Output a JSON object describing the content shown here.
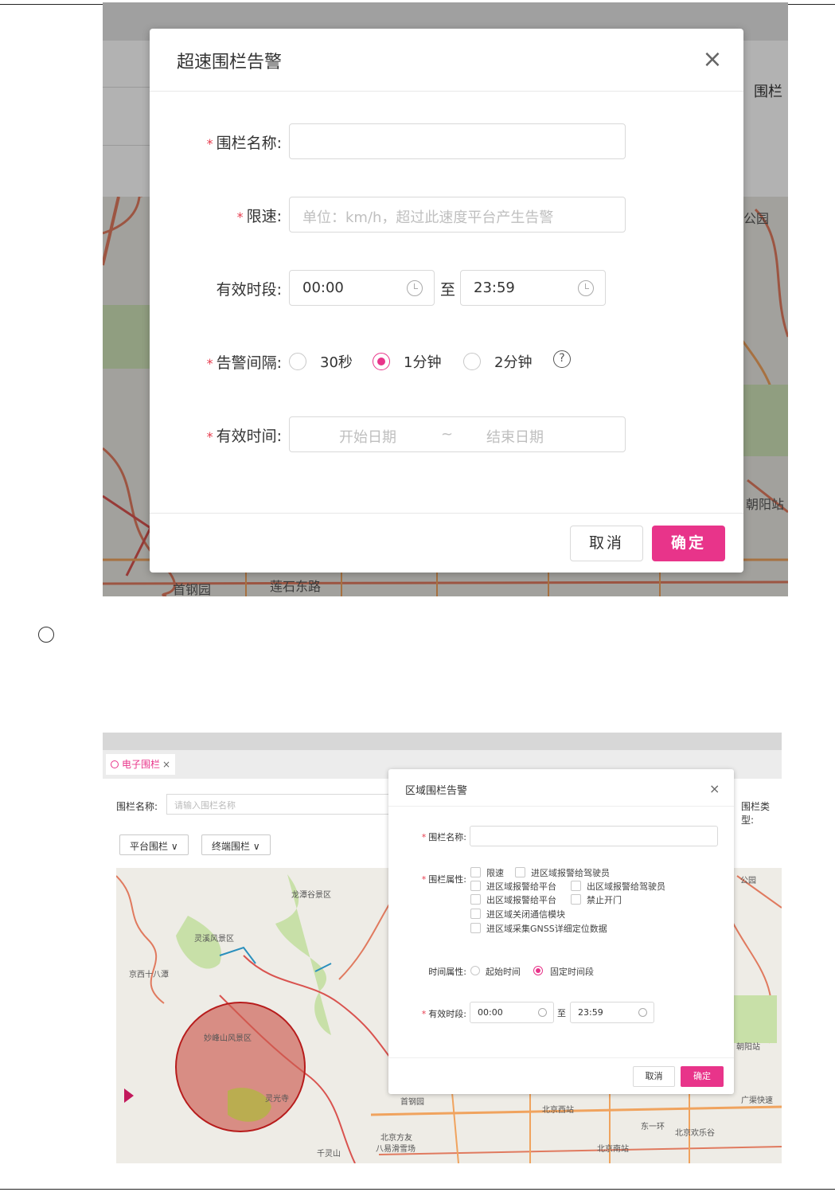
{
  "shot1": {
    "side_label": "围栏",
    "map_labels": [
      "公园",
      "朝阳站",
      "首钢园",
      "莲石东路"
    ],
    "dialog": {
      "title": "超速围栏告警",
      "close_icon": "close-icon",
      "fence_name": {
        "label": "围栏名称:",
        "value": ""
      },
      "speed": {
        "label": "限速:",
        "placeholder": "单位：km/h，超过此速度平台产生告警"
      },
      "valid_period": {
        "label": "有效时段:",
        "start": "00:00",
        "to": "至",
        "end": "23:59"
      },
      "alarm_interval": {
        "label": "告警间隔:",
        "options": [
          "30秒",
          "1分钟",
          "2分钟"
        ],
        "selected": "1分钟",
        "help": "?"
      },
      "valid_time": {
        "label": "有效时间:",
        "start_placeholder": "开始日期",
        "sep": "~",
        "end_placeholder": "结束日期"
      },
      "cancel": "取消",
      "ok": "确定"
    }
  },
  "shot2": {
    "tab": {
      "label": "电子围栏",
      "close": "×"
    },
    "filter": {
      "label": "围栏名称:",
      "placeholder": "请输入围栏名称"
    },
    "type_label": "围栏类型:",
    "dropdowns": [
      "平台围栏 ∨",
      "终端围栏 ∨"
    ],
    "map_labels": [
      "龙潭谷景区",
      "灵溪风景区",
      "京西十八潭",
      "妙峰山风景区",
      "灵光寺",
      "千灵山",
      "北京方友",
      "八易滑雪场",
      "首钢园",
      "北京西站",
      "北京欢乐谷",
      "北京南站",
      "公园",
      "朝阳站",
      "东一环",
      "广渠快速"
    ],
    "dialog": {
      "title": "区域围栏告警",
      "close": "×",
      "fence_name_label": "围栏名称:",
      "fence_attr_label": "围栏属性:",
      "attrs": [
        "限速",
        "进区域报警给驾驶员",
        "进区域报警给平台",
        "出区域报警给驾驶员",
        "出区域报警给平台",
        "禁止开门",
        "进区域关闭通信模块",
        "进区域采集GNSS详细定位数据"
      ],
      "time_attr_label": "时间属性:",
      "time_attr_options": [
        "起始时间",
        "固定时间段"
      ],
      "time_attr_selected": "固定时间段",
      "valid_period_label": "有效时段:",
      "start": "00:00",
      "to": "至",
      "end": "23:59",
      "cancel": "取消",
      "ok": "确定"
    }
  }
}
